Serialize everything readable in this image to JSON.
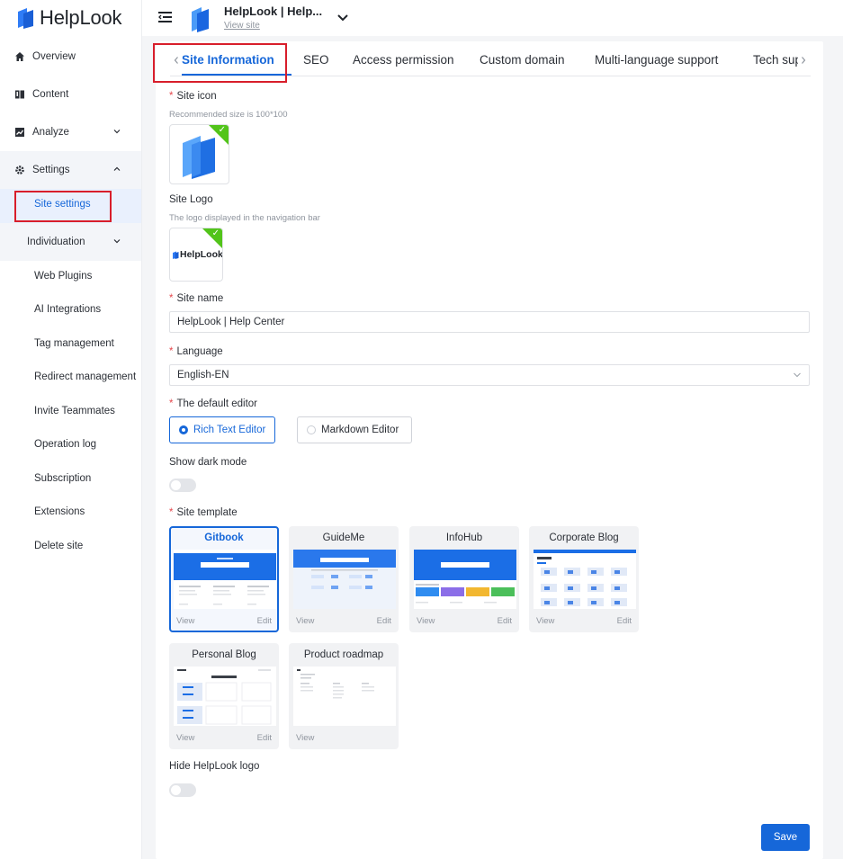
{
  "app": {
    "brand": "HelpLook"
  },
  "sidebar": {
    "overview": "Overview",
    "content": "Content",
    "analyze": "Analyze",
    "settings": "Settings",
    "site_settings": "Site settings",
    "individuation": "Individuation",
    "items": [
      "Web Plugins",
      "AI Integrations",
      "Tag management",
      "Redirect management",
      "Invite Teammates",
      "Operation log",
      "Subscription",
      "Extensions",
      "Delete site"
    ]
  },
  "topbar": {
    "site_title": "HelpLook | Help...",
    "view_site": "View site"
  },
  "tabs": [
    "Site Information",
    "SEO",
    "Access permission",
    "Custom domain",
    "Multi-language support",
    "Tech sup"
  ],
  "form": {
    "site_icon_label": "Site icon",
    "site_icon_hint": "Recommended size is 100*100",
    "site_logo_label": "Site Logo",
    "site_logo_hint": "The logo displayed in the navigation bar",
    "logo_preview_text": "HelpLook",
    "site_name_label": "Site name",
    "site_name_value": "HelpLook | Help Center",
    "language_label": "Language",
    "language_value": "English-EN",
    "editor_label": "The default editor",
    "editor_options": [
      "Rich Text Editor",
      "Markdown Editor"
    ],
    "editor_selected": "Rich Text Editor",
    "dark_mode_label": "Show dark mode",
    "dark_mode_on": false,
    "template_label": "Site template",
    "hide_logo_label": "Hide HelpLook logo",
    "hide_logo_on": false,
    "save": "Save"
  },
  "templates": [
    {
      "name": "Gitbook",
      "view": "View",
      "edit": "Edit",
      "selected": true
    },
    {
      "name": "GuideMe",
      "view": "View",
      "edit": "Edit"
    },
    {
      "name": "InfoHub",
      "view": "View",
      "edit": "Edit"
    },
    {
      "name": "Corporate Blog",
      "view": "View",
      "edit": "Edit"
    },
    {
      "name": "Personal Blog",
      "view": "View",
      "edit": "Edit"
    },
    {
      "name": "Product roadmap",
      "view": "View",
      "edit": ""
    }
  ],
  "colors": {
    "accent": "#1667d9",
    "success": "#52c41a",
    "required": "#e5484d",
    "highlight_box": "#d81e2b"
  }
}
